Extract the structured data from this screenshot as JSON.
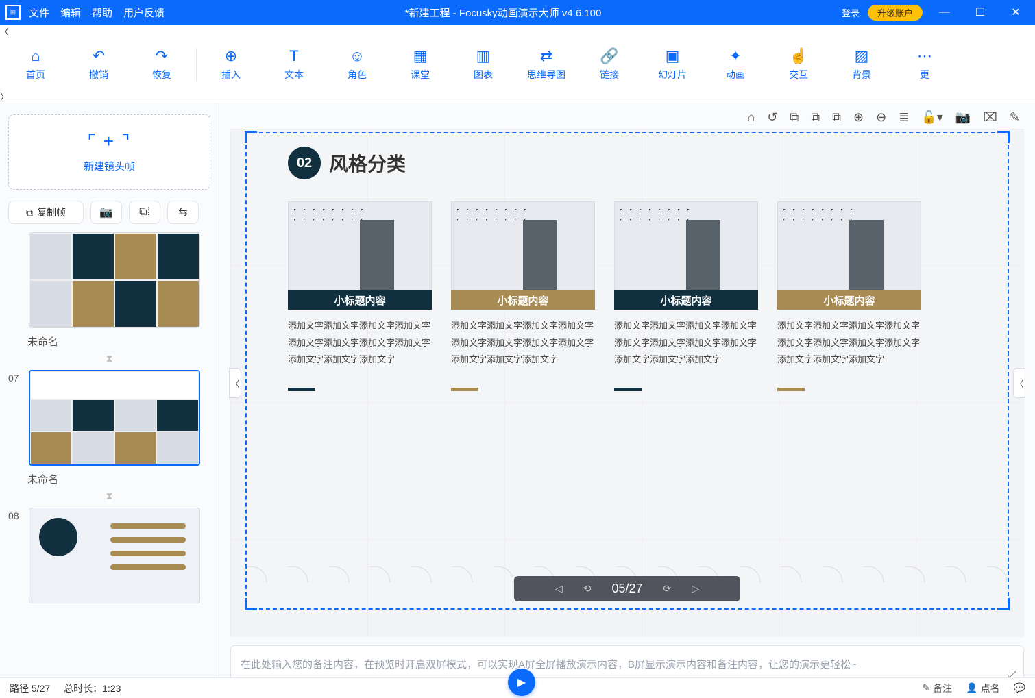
{
  "titlebar": {
    "menus": [
      "文件",
      "编辑",
      "帮助",
      "用户反馈"
    ],
    "title": "*新建工程 - Focusky动画演示大师  v4.6.100",
    "login": "登录",
    "upgrade": "升级账户"
  },
  "ribbon": [
    {
      "icon": "⌂",
      "label": "首页"
    },
    {
      "icon": "↶",
      "label": "撤销"
    },
    {
      "icon": "↷",
      "label": "恢复"
    },
    {
      "sep": true
    },
    {
      "icon": "⊕",
      "label": "插入"
    },
    {
      "icon": "T",
      "label": "文本"
    },
    {
      "icon": "☺",
      "label": "角色"
    },
    {
      "icon": "▦",
      "label": "课堂"
    },
    {
      "icon": "▥",
      "label": "图表"
    },
    {
      "icon": "⇄",
      "label": "思维导图"
    },
    {
      "icon": "🔗",
      "label": "链接"
    },
    {
      "icon": "▣",
      "label": "幻灯片"
    },
    {
      "icon": "✦",
      "label": "动画"
    },
    {
      "icon": "☝",
      "label": "交互"
    },
    {
      "icon": "▨",
      "label": "背景"
    },
    {
      "icon": "⋯",
      "label": "更"
    }
  ],
  "canvasToolbar": [
    "⌂",
    "↺",
    "⧉",
    "⧉",
    "⧉",
    "⊕",
    "⊖",
    "≣",
    "🔓▾",
    "📷",
    "⌧",
    "✎"
  ],
  "sidebar": {
    "newFrame": "新建镜头帧",
    "copyFrame": "复制帧",
    "thumbs": [
      {
        "num": "",
        "title": "未命名",
        "selected": false
      },
      {
        "num": "07",
        "title": "未命名",
        "selected": true
      },
      {
        "num": "08",
        "title": "",
        "selected": false
      }
    ]
  },
  "slide": {
    "badge": "02",
    "title": "风格分类",
    "cards": [
      {
        "barClass": "navy",
        "accent": "navy",
        "bar": "小标题内容",
        "body": "添加文字添加文字添加文字添加文字添加文字添加文字添加文字添加文字添加文字添加文字添加文字"
      },
      {
        "barClass": "olive",
        "accent": "olive",
        "bar": "小标题内容",
        "body": "添加文字添加文字添加文字添加文字添加文字添加文字添加文字添加文字添加文字添加文字添加文字"
      },
      {
        "barClass": "navy",
        "accent": "navy",
        "bar": "小标题内容",
        "body": "添加文字添加文字添加文字添加文字添加文字添加文字添加文字添加文字添加文字添加文字添加文字"
      },
      {
        "barClass": "olive",
        "accent": "olive",
        "bar": "小标题内容",
        "body": "添加文字添加文字添加文字添加文字添加文字添加文字添加文字添加文字添加文字添加文字添加文字"
      }
    ],
    "pagePill": "05/27"
  },
  "notes": {
    "placeholder": "在此处输入您的备注内容，在预览时开启双屏模式，可以实现A屏全屏播放演示内容，B屏显示演示内容和备注内容，让您的演示更轻松~"
  },
  "status": {
    "path": "路径 5/27",
    "duration": "总时长：1:23",
    "notes": "备注",
    "likes": "点名",
    "chat": "⋯"
  }
}
